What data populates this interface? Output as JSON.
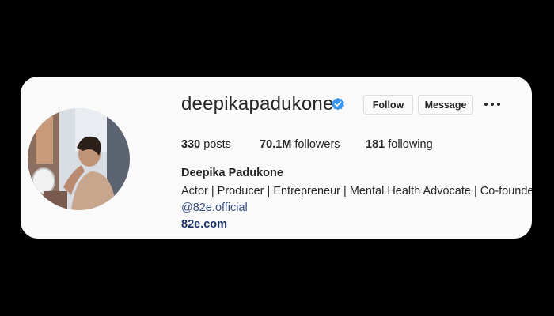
{
  "profile": {
    "username": "deepikapadukone",
    "verified_icon": "verified-badge-icon",
    "full_name": "Deepika Padukone",
    "bio": "Actor | Producer | Entrepreneur | Mental Health Advocate | Co-founder",
    "mention": "@82e.official",
    "website": "82e.com"
  },
  "actions": {
    "follow_label": "Follow",
    "message_label": "Message",
    "more_icon": "more-options-icon"
  },
  "stats": {
    "posts_count": "330",
    "posts_label": "posts",
    "followers_count": "70.1M",
    "followers_label": "followers",
    "following_count": "181",
    "following_label": "following"
  },
  "colors": {
    "verified_blue": "#3897f0",
    "link_blue": "#385185",
    "website_blue": "#1c3366"
  }
}
